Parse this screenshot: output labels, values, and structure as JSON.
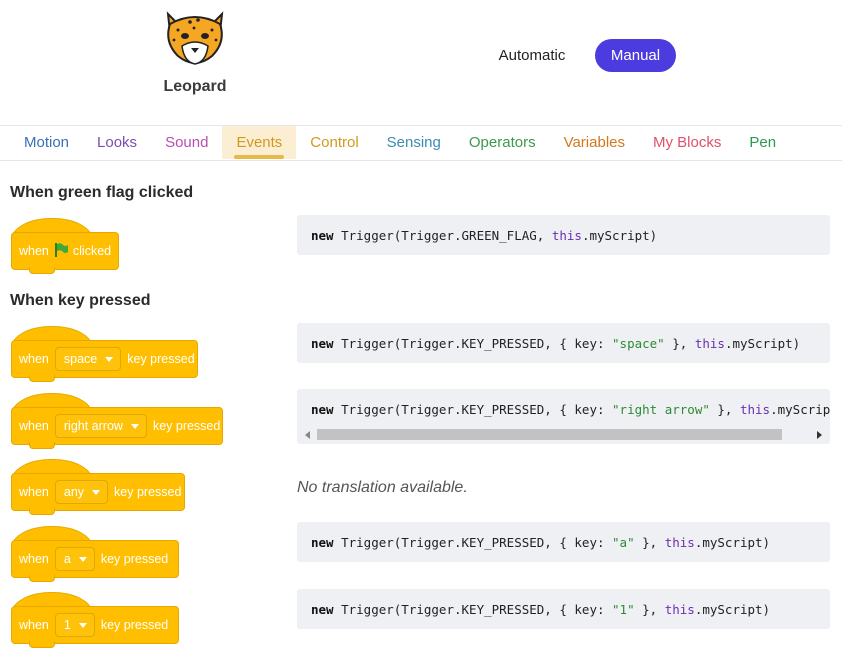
{
  "header": {
    "logo_text": "Leopard",
    "mode_automatic": "Automatic",
    "mode_manual": "Manual"
  },
  "tabs": [
    {
      "label": "Motion",
      "color": "#3b6fb7"
    },
    {
      "label": "Looks",
      "color": "#7a4fb0"
    },
    {
      "label": "Sound",
      "color": "#b54fb0"
    },
    {
      "label": "Events",
      "color": "#d19a1a"
    },
    {
      "label": "Control",
      "color": "#d19a1a"
    },
    {
      "label": "Sensing",
      "color": "#3b8bb5"
    },
    {
      "label": "Operators",
      "color": "#3c9a4a"
    },
    {
      "label": "Variables",
      "color": "#d2781e"
    },
    {
      "label": "My Blocks",
      "color": "#e0506a"
    },
    {
      "label": "Pen",
      "color": "#2b9a4e"
    }
  ],
  "active_tab": "Events",
  "sections": {
    "green_flag_title": "When green flag clicked",
    "key_pressed_title": "When key pressed"
  },
  "blocks": {
    "green_flag": {
      "when": "when",
      "clicked": "clicked"
    },
    "key_space": {
      "when": "when",
      "key": "space",
      "suffix": "key pressed"
    },
    "key_right": {
      "when": "when",
      "key": "right arrow",
      "suffix": "key pressed"
    },
    "key_any": {
      "when": "when",
      "key": "any",
      "suffix": "key pressed"
    },
    "key_a": {
      "when": "when",
      "key": "a",
      "suffix": "key pressed"
    },
    "key_1": {
      "when": "when",
      "key": "1",
      "suffix": "key pressed"
    }
  },
  "code": {
    "green_flag": {
      "kw": "new",
      "pre": " Trigger(Trigger.GREEN_FLAG, ",
      "this": "this",
      "post": ".myScript)"
    },
    "key_space": {
      "kw": "new",
      "pre": " Trigger(Trigger.KEY_PRESSED, { key: ",
      "str": "\"space\"",
      "mid": " }, ",
      "this": "this",
      "post": ".myScript)"
    },
    "key_right": {
      "kw": "new",
      "pre": " Trigger(Trigger.KEY_PRESSED, { key: ",
      "str": "\"right arrow\"",
      "mid": " }, ",
      "this": "this",
      "post": ".myScript)"
    },
    "key_a": {
      "kw": "new",
      "pre": " Trigger(Trigger.KEY_PRESSED, { key: ",
      "str": "\"a\"",
      "mid": " }, ",
      "this": "this",
      "post": ".myScript)"
    },
    "key_1": {
      "kw": "new",
      "pre": " Trigger(Trigger.KEY_PRESSED, { key: ",
      "str": "\"1\"",
      "mid": " }, ",
      "this": "this",
      "post": ".myScript)"
    }
  },
  "no_translation": "No translation available.",
  "colors": {
    "accent": "#4c3bde",
    "block_fill": "#ffbf00",
    "flag_green": "#3fa83a"
  }
}
